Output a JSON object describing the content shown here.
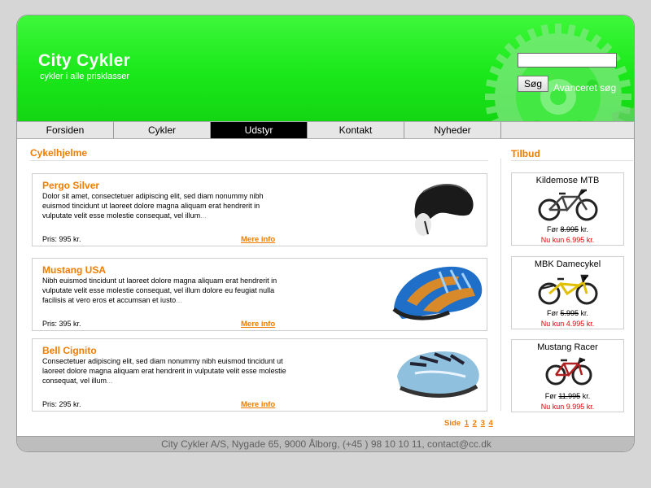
{
  "header": {
    "title": "City Cykler",
    "subtitle": "cykler i alle prisklasser",
    "search_value": "",
    "search_button": "Søg",
    "advanced_search": "Avanceret søg"
  },
  "nav": {
    "items": [
      {
        "label": "Forsiden"
      },
      {
        "label": "Cykler"
      },
      {
        "label": "Udstyr",
        "active": true
      },
      {
        "label": "Kontakt"
      },
      {
        "label": "Nyheder"
      }
    ]
  },
  "main": {
    "title": "Cykelhjelme",
    "products": [
      {
        "name": "Pergo Silver",
        "description": "Dolor sit amet, consectetuer adipiscing elit, sed diam nonummy nibh euismod tincidunt ut laoreet dolore magna aliquam erat hendrerit in vulputate velit esse molestie consequat, vel illum",
        "ellipsis": "...",
        "price": "Pris: 995 kr.",
        "more": "Mere info"
      },
      {
        "name": "Mustang USA",
        "description": "Nibh euismod tincidunt ut laoreet dolore magna aliquam erat hendrerit in vulputate velit esse molestie consequat, vel illum dolore eu feugiat nulla facilisis at vero eros et accumsan et iusto",
        "ellipsis": "...",
        "price": "Pris: 395 kr.",
        "more": "Mere info"
      },
      {
        "name": "Bell Cignito",
        "description": "Consectetuer adipiscing elit, sed diam nonummy nibh euismod tincidunt ut laoreet dolore magna aliquam erat hendrerit in vulputate velit esse molestie consequat, vel illum",
        "ellipsis": "...",
        "price": "Pris: 295 kr.",
        "more": "Mere info"
      }
    ],
    "pager": {
      "label": "Side",
      "pages": [
        "1",
        "2",
        "3",
        "4"
      ]
    }
  },
  "sidebar": {
    "title": "Tilbud",
    "offers": [
      {
        "name": "Kildemose MTB",
        "before_label": "Før",
        "before_price": "8.995",
        "before_unit": "kr.",
        "now": "Nu kun 6.995 kr."
      },
      {
        "name": "MBK Damecykel",
        "before_label": "Før",
        "before_price": "5.995",
        "before_unit": "kr.",
        "now": "Nu kun 4.995 kr."
      },
      {
        "name": "Mustang Racer",
        "before_label": "Før",
        "before_price": "11.995",
        "before_unit": "kr.",
        "now": "Nu kun 9.995 kr."
      }
    ]
  },
  "footer": {
    "text": "City Cykler A/S, Nygade 65, 9000 Ålborg, (+45 ) 98 10 10 11, contact@cc.dk"
  },
  "colors": {
    "header_green": "#1ae81a",
    "accent_orange": "#ef7d00",
    "offer_red": "#e50000",
    "nav_active": "#000000"
  }
}
